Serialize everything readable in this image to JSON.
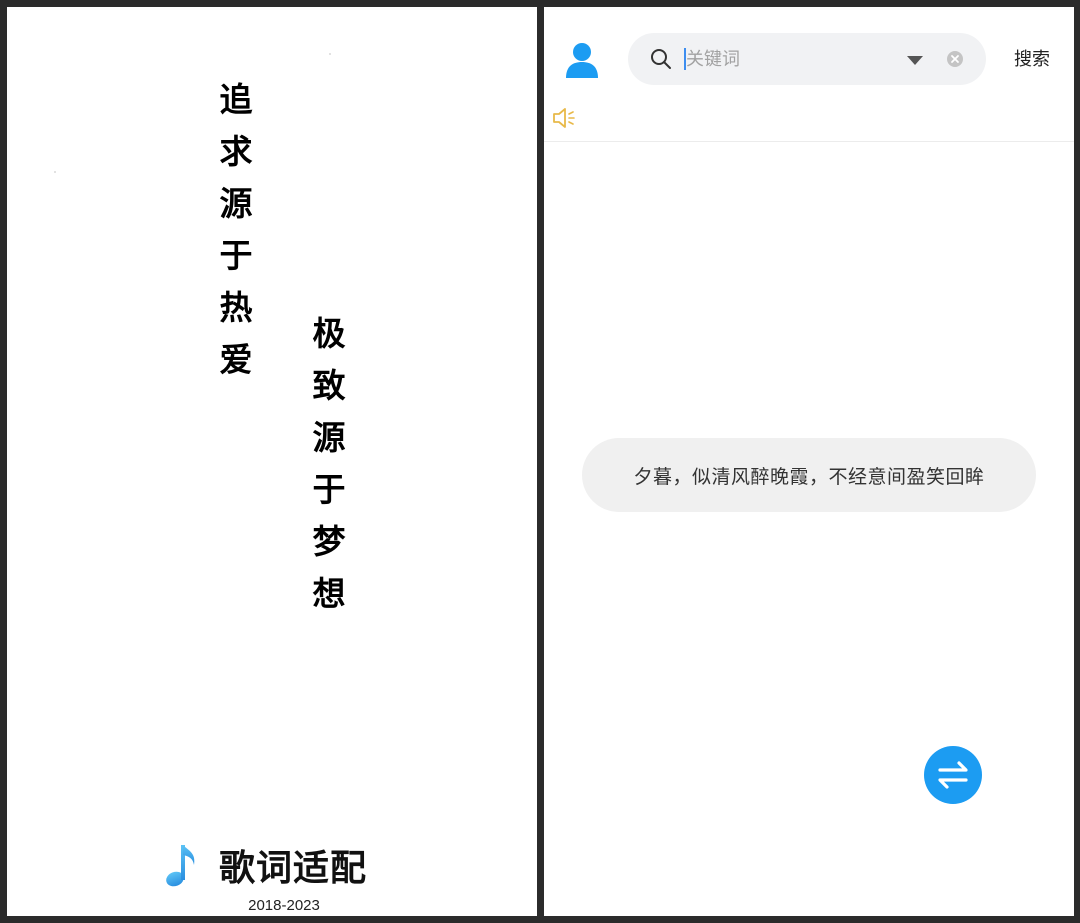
{
  "splash": {
    "slogan_line1": [
      "追",
      "求",
      "源",
      "于",
      "热",
      "爱"
    ],
    "slogan_line2": [
      "极",
      "致",
      "源",
      "于",
      "梦",
      "想"
    ],
    "app_name": "歌词适配",
    "years": "2018-2023",
    "logo_icon": "music-note-icon"
  },
  "app": {
    "search": {
      "placeholder": "关键词",
      "value": "",
      "button_label": "搜索"
    },
    "lyric": "夕暮，似清风醉晚霞，不经意间盈笑回眸",
    "icons": {
      "avatar": "user-avatar-icon",
      "search": "search-icon",
      "dropdown": "dropdown-arrow-icon",
      "clear": "clear-icon",
      "speaker": "speaker-icon",
      "swap": "swap-arrows-icon"
    },
    "colors": {
      "accent": "#1c9cf2",
      "speaker": "#e8b949",
      "search_bg": "#f1f2f4",
      "bubble_bg": "#f0f0f0"
    }
  }
}
